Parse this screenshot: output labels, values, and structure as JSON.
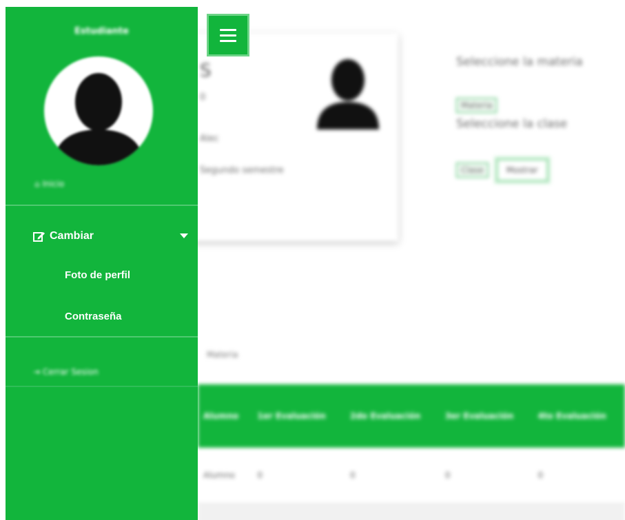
{
  "sidebar": {
    "username": "Estudiante",
    "home_label": "Inicio",
    "menu_label": "Cambiar",
    "submenu": [
      "Foto de perfil",
      "Contraseña"
    ],
    "logout_label": "Cerrar Sesion"
  },
  "profile_card": {
    "name_initial": "S",
    "line_1": "0",
    "line_2": "Alec",
    "line_3": "Segundo semestre"
  },
  "selectors": {
    "subject_label": "Seleccione la materia",
    "subject_value": "Materia",
    "class_label": "Seleccione la clase",
    "class_value": "Clase",
    "show_button": "Mostrar"
  },
  "table": {
    "caption": "Materia",
    "headers": [
      "Alumno",
      "1er Evaluación",
      "2do Evaluación",
      "3er Evaluación",
      "4to Evaluación"
    ],
    "rows": [
      [
        "Alumno",
        "0",
        "0",
        "0",
        "0"
      ]
    ]
  },
  "colors": {
    "primary": "#12b53c",
    "primary_light": "#6ed488"
  },
  "icons": [
    "menu-icon",
    "user-silhouette-icon",
    "edit-icon",
    "chevron-down-icon",
    "logout-icon",
    "home-icon"
  ]
}
